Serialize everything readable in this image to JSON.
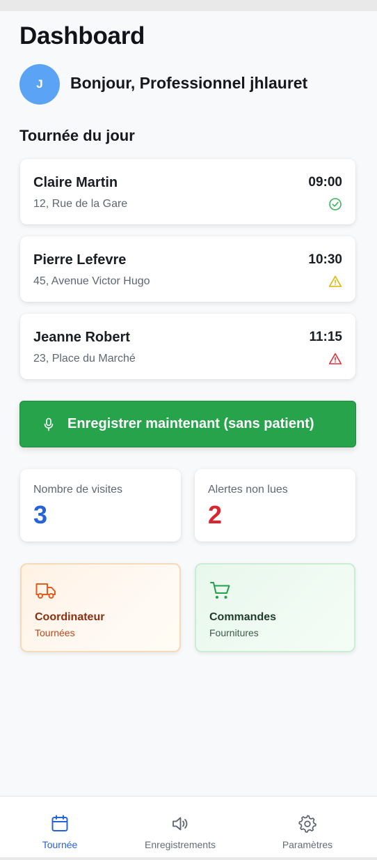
{
  "header": {
    "title": "Dashboard",
    "avatar_initial": "J",
    "greeting": "Bonjour, Professionnel jhlauret"
  },
  "tour": {
    "section_title": "Tournée du jour",
    "visits": [
      {
        "name": "Claire Martin",
        "address": "12, Rue de la Gare",
        "time": "09:00",
        "status": "check-circle-icon",
        "status_color": "#3cb45a"
      },
      {
        "name": "Pierre Lefevre",
        "address": "45, Avenue Victor Hugo",
        "time": "10:30",
        "status": "warning-icon",
        "status_color": "#e0b400"
      },
      {
        "name": "Jeanne Robert",
        "address": "23, Place du Marché",
        "time": "11:15",
        "status": "alert-icon",
        "status_color": "#e0303a"
      }
    ]
  },
  "record_button": {
    "label": "Enregistrer maintenant (sans patient)",
    "icon": "microphone-icon",
    "color": "#27a34b"
  },
  "stats": [
    {
      "label": "Nombre de visites",
      "value": "3",
      "color": "#2563d9"
    },
    {
      "label": "Alertes non lues",
      "value": "2",
      "color": "#d6262f"
    }
  ],
  "tiles": [
    {
      "title": "Coordinateur",
      "subtitle": "Tournées",
      "icon": "truck-icon",
      "color": "#e85a1a"
    },
    {
      "title": "Commandes",
      "subtitle": "Fournitures",
      "icon": "cart-icon",
      "color": "#22a04a"
    }
  ],
  "tabbar": {
    "tabs": [
      {
        "label": "Tournée",
        "icon": "calendar-icon",
        "active": true
      },
      {
        "label": "Enregistrements",
        "icon": "speaker-icon",
        "active": false
      },
      {
        "label": "Paramètres",
        "icon": "gear-icon",
        "active": false
      }
    ],
    "active_color": "#2563d9"
  }
}
